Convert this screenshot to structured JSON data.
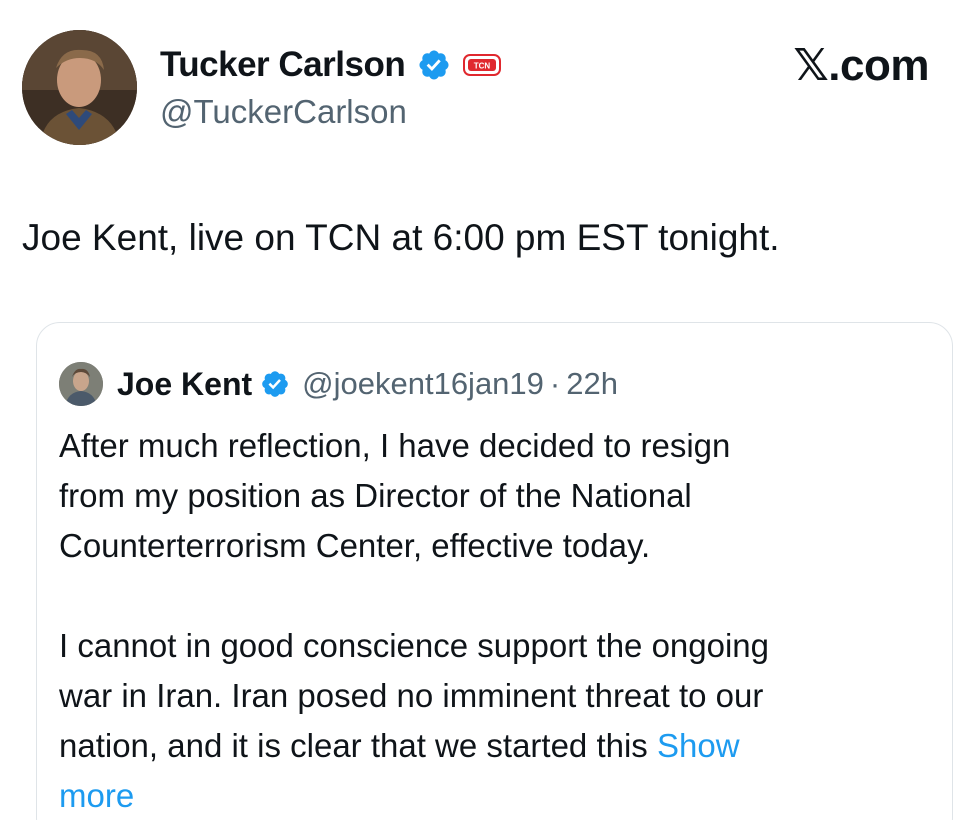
{
  "post": {
    "author": {
      "name": "Tucker Carlson",
      "handle": "@TuckerCarlson",
      "verified": true,
      "affiliate_badge": "TCN"
    },
    "site_label": "𝕏.com",
    "text": "Joe Kent, live on TCN at 6:00 pm EST tonight."
  },
  "quoted_post": {
    "author": {
      "name": "Joe Kent",
      "handle": "@joekent16jan19",
      "verified": true
    },
    "separator": "·",
    "time": "22h",
    "paragraph1_lines": [
      "After much reflection, I have decided to resign",
      "from my position as Director of the National",
      "Counterterrorism Center, effective today."
    ],
    "paragraph2_lines": [
      "I cannot in good conscience support the ongoing",
      "war in Iran. Iran posed no imminent threat to our",
      "nation, and it is clear that we started this "
    ],
    "show_more_part1": "Show",
    "show_more_part2": "more"
  },
  "colors": {
    "text": "#0f1419",
    "secondary_text": "#536471",
    "link": "#1d9bf0",
    "verified": "#1d9bf0",
    "tcn_badge": "#e0282e",
    "card_border": "#dfe4e8"
  },
  "icons": {
    "verified": "verified-check-icon",
    "affiliate": "tcn-badge-icon"
  }
}
